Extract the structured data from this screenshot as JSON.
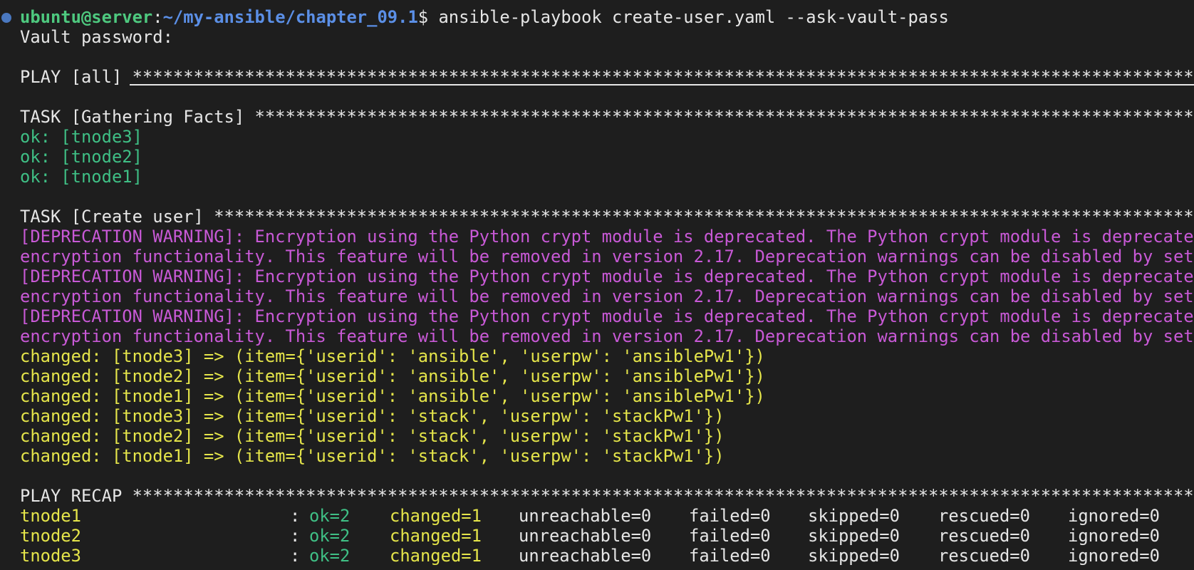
{
  "colors": {
    "background": "#1e1e1e",
    "text": "#e6e6e6",
    "prompt_user": "#4ec97f",
    "prompt_path": "#5b8fe6",
    "ok": "#3fbf85",
    "changed": "#e5e54a",
    "warning": "#c859d6",
    "status_dot": "#4a78c0"
  },
  "prompt": {
    "user_host": "ubuntu@server",
    "separator": ":",
    "cwd": "~/my-ansible/chapter_09.1",
    "dollar": "$ ",
    "command": "ansible-playbook create-user.yaml --ask-vault-pass"
  },
  "vault_prompt": "Vault password:",
  "play_header": "PLAY [all] ***************************************************************************************************************************************",
  "gather_header": "TASK [Gathering Facts] ***************************************************************************************************************************",
  "gather_results": [
    "ok: [tnode3]",
    "ok: [tnode2]",
    "ok: [tnode1]"
  ],
  "create_header": "TASK [Create user] *******************************************************************************************************************************",
  "warnings": [
    "[DEPRECATION WARNING]: Encryption using the Python crypt module is deprecated. The Python crypt module is deprecated a",
    "encryption functionality. This feature will be removed in version 2.17. Deprecation warnings can be disabled by settin",
    "[DEPRECATION WARNING]: Encryption using the Python crypt module is deprecated. The Python crypt module is deprecated a",
    "encryption functionality. This feature will be removed in version 2.17. Deprecation warnings can be disabled by settin",
    "[DEPRECATION WARNING]: Encryption using the Python crypt module is deprecated. The Python crypt module is deprecated a",
    "encryption functionality. This feature will be removed in version 2.17. Deprecation warnings can be disabled by settin"
  ],
  "changed_results": [
    "changed: [tnode3] => (item={'userid': 'ansible', 'userpw': 'ansiblePw1'})",
    "changed: [tnode2] => (item={'userid': 'ansible', 'userpw': 'ansiblePw1'})",
    "changed: [tnode1] => (item={'userid': 'ansible', 'userpw': 'ansiblePw1'})",
    "changed: [tnode3] => (item={'userid': 'stack', 'userpw': 'stackPw1'})",
    "changed: [tnode2] => (item={'userid': 'stack', 'userpw': 'stackPw1'})",
    "changed: [tnode1] => (item={'userid': 'stack', 'userpw': 'stackPw1'})"
  ],
  "recap_header": "PLAY RECAP ***************************************************************************************************************************************",
  "recap_rows": [
    {
      "host": "tnode1",
      "colon": ":",
      "ok": "ok=2",
      "changed": "changed=1",
      "unreachable": "unreachable=0",
      "failed": "failed=0",
      "skipped": "skipped=0",
      "rescued": "rescued=0",
      "ignored": "ignored=0"
    },
    {
      "host": "tnode2",
      "colon": ":",
      "ok": "ok=2",
      "changed": "changed=1",
      "unreachable": "unreachable=0",
      "failed": "failed=0",
      "skipped": "skipped=0",
      "rescued": "rescued=0",
      "ignored": "ignored=0"
    },
    {
      "host": "tnode3",
      "colon": ":",
      "ok": "ok=2",
      "changed": "changed=1",
      "unreachable": "unreachable=0",
      "failed": "failed=0",
      "skipped": "skipped=0",
      "rescued": "rescued=0",
      "ignored": "ignored=0"
    }
  ]
}
